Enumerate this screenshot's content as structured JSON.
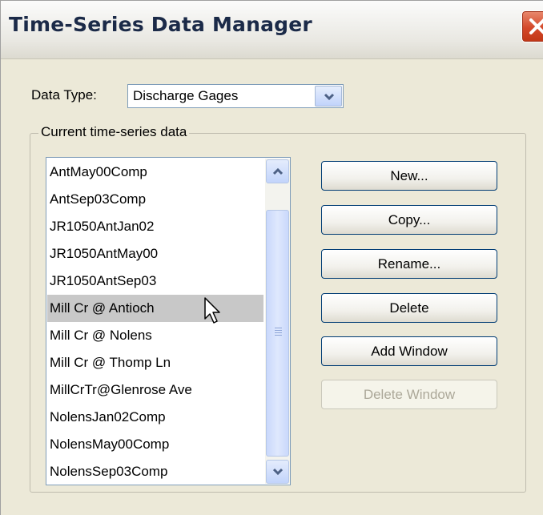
{
  "window": {
    "title": "Time-Series Data Manager"
  },
  "data_type": {
    "label": "Data Type:",
    "value": "Discharge Gages"
  },
  "group": {
    "title": "Current time-series data"
  },
  "list": {
    "items": [
      "AntMay00Comp",
      "AntSep03Comp",
      "JR1050AntJan02",
      "JR1050AntMay00",
      "JR1050AntSep03",
      "Mill Cr @ Antioch",
      "Mill Cr @ Nolens",
      "Mill Cr @ Thomp Ln",
      "MillCrTr@Glenrose Ave",
      "NolensJan02Comp",
      "NolensMay00Comp",
      "NolensSep03Comp"
    ],
    "selected": "Mill Cr @ Antioch"
  },
  "buttons": {
    "new": "New...",
    "copy": "Copy...",
    "rename": "Rename...",
    "delete": "Delete",
    "add_window": "Add Window",
    "delete_window": "Delete Window"
  },
  "colors": {
    "dialog_background": "#ece9d8",
    "selection": "#c8c8c8",
    "close_button": "#d4482a"
  },
  "icons": {
    "close": "close-x-icon",
    "dropdown": "chevron-down-icon",
    "scroll_up": "chevron-up-icon",
    "scroll_down": "chevron-down-icon",
    "cursor": "mouse-pointer-icon"
  }
}
